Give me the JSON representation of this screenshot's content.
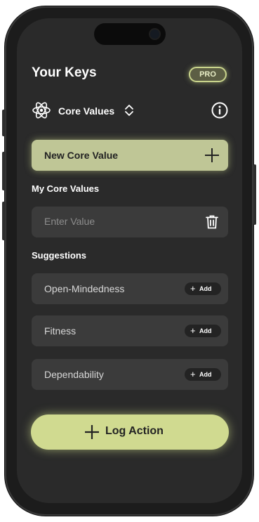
{
  "header": {
    "title": "Your Keys",
    "pro_badge": "PRO"
  },
  "selector": {
    "label": "Core Values",
    "icon": "atom-icon"
  },
  "new_value_button": {
    "label": "New Core Value"
  },
  "my_values": {
    "heading": "My Core Values",
    "input": {
      "placeholder": "Enter Value",
      "value": ""
    }
  },
  "suggestions": {
    "heading": "Suggestions",
    "add_label": "Add",
    "items": [
      {
        "label": "Open-Mindedness"
      },
      {
        "label": "Fitness"
      },
      {
        "label": "Dependability"
      }
    ]
  },
  "log_button": {
    "label": "Log Action"
  },
  "colors": {
    "background": "#2a2a2a",
    "accent": "#d0da90",
    "card": "#3b3b3b",
    "text": "#ffffff"
  }
}
